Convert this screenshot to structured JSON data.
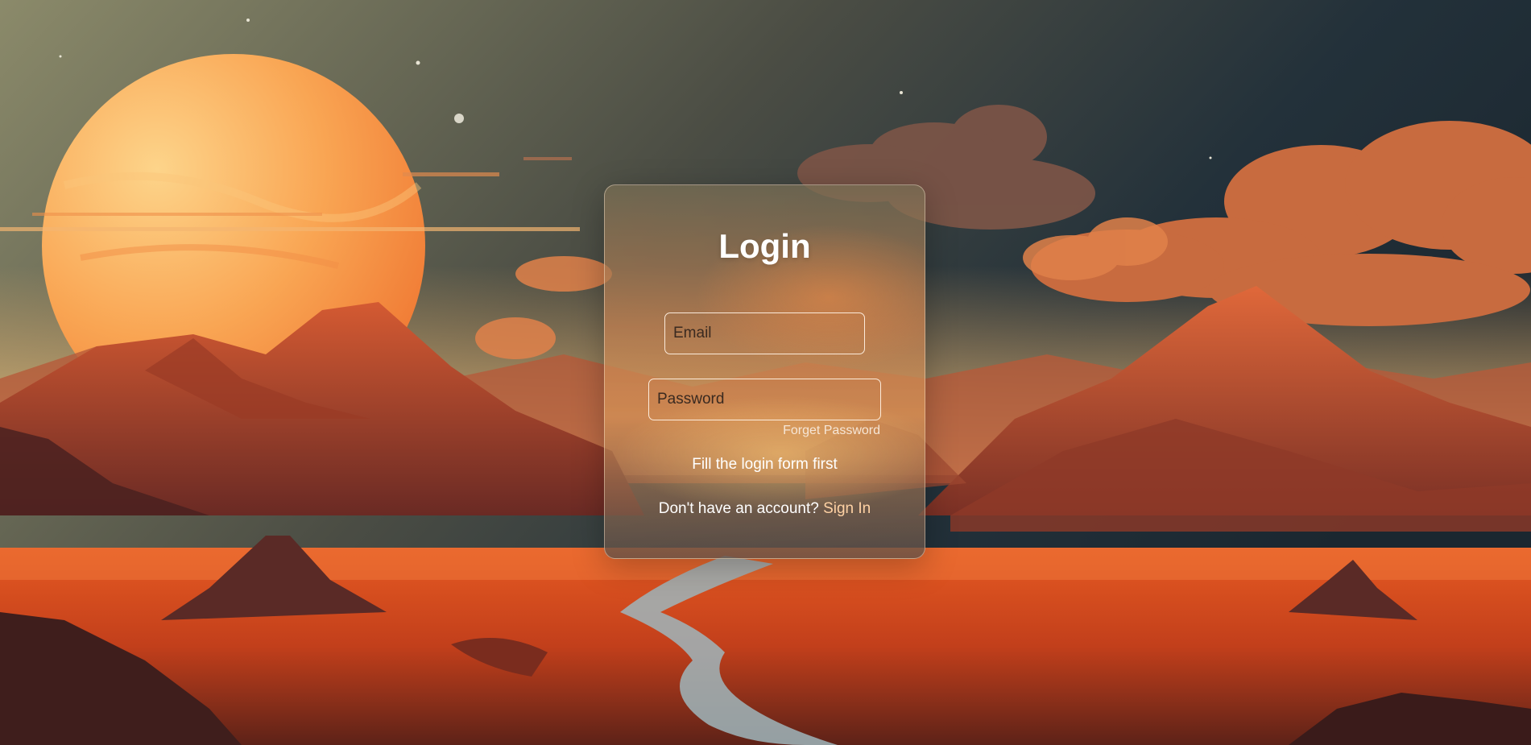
{
  "login": {
    "title": "Login",
    "email_placeholder": "Email",
    "password_placeholder": "Password",
    "forgot_password": "Forget Password",
    "status_message": "Fill the login form first",
    "signup_prompt": "Don't have an account?",
    "signup_link": "Sign In"
  },
  "background": {
    "description_icon": "desert-landscape-illustration",
    "sky_top_color": "#1e2a2f",
    "sun_color": "#f9a64e",
    "mountain_color": "#c64a2a",
    "ground_color": "#e0501f"
  }
}
